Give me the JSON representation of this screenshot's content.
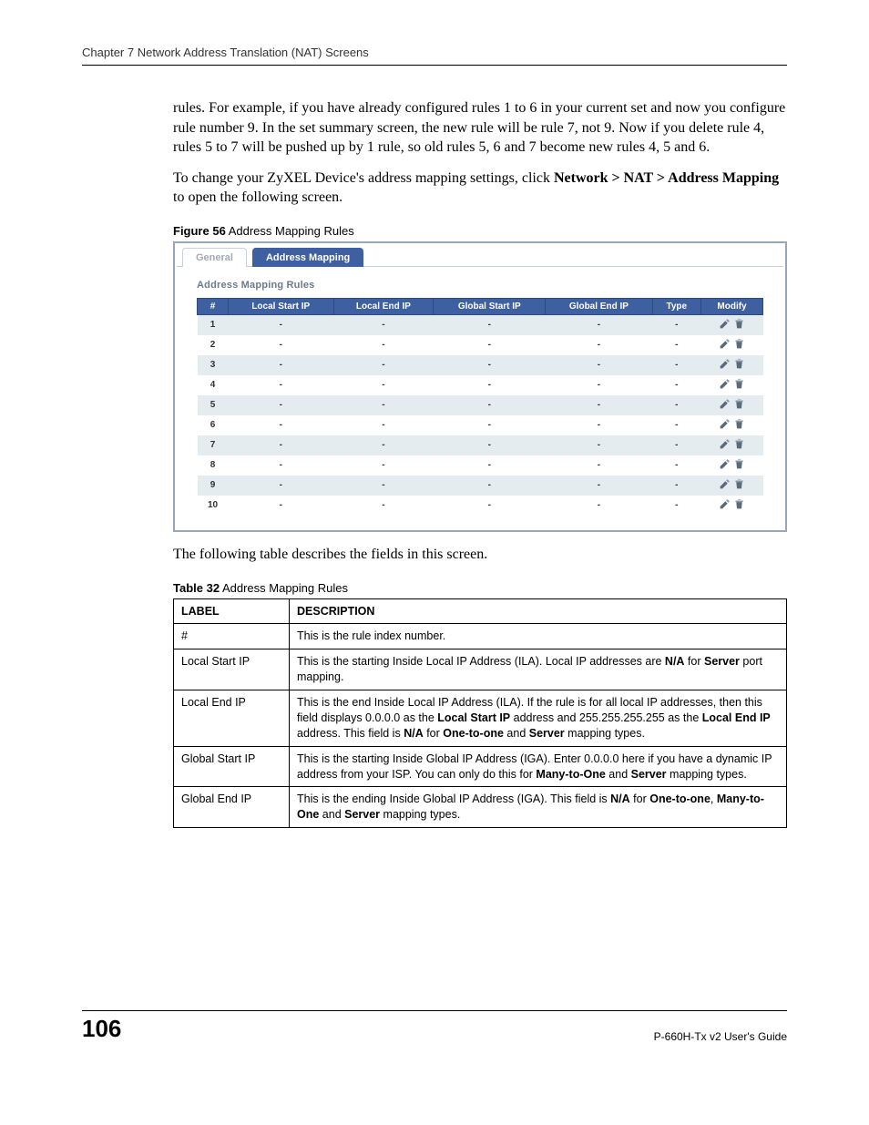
{
  "header": "Chapter 7 Network Address Translation (NAT) Screens",
  "para1_a": "rules. For example, if you have already configured rules 1 to 6 in your current set and now you configure rule number 9. In the set summary screen, the new rule will be rule 7, not 9. Now if you delete rule 4, rules 5 to 7 will be pushed up by 1 rule, so old rules 5, 6 and 7 become new rules 4, 5 and 6.",
  "para2_a": "To change your ZyXEL Device's address mapping settings, click ",
  "para2_b": "Network > NAT > Address Mapping",
  "para2_c": " to open the following screen.",
  "figure_caption_bold": "Figure 56",
  "figure_caption_rest": "   Address Mapping Rules",
  "tabs": {
    "general": "General",
    "mapping": "Address Mapping"
  },
  "panel_title": "Address Mapping Rules",
  "cols": {
    "idx": "#",
    "lstart": "Local Start IP",
    "lend": "Local End IP",
    "gstart": "Global Start IP",
    "gend": "Global End IP",
    "type": "Type",
    "modify": "Modify"
  },
  "rows": [
    {
      "n": "1",
      "a": "-",
      "b": "-",
      "c": "-",
      "d": "-",
      "e": "-"
    },
    {
      "n": "2",
      "a": "-",
      "b": "-",
      "c": "-",
      "d": "-",
      "e": "-"
    },
    {
      "n": "3",
      "a": "-",
      "b": "-",
      "c": "-",
      "d": "-",
      "e": "-"
    },
    {
      "n": "4",
      "a": "-",
      "b": "-",
      "c": "-",
      "d": "-",
      "e": "-"
    },
    {
      "n": "5",
      "a": "-",
      "b": "-",
      "c": "-",
      "d": "-",
      "e": "-"
    },
    {
      "n": "6",
      "a": "-",
      "b": "-",
      "c": "-",
      "d": "-",
      "e": "-"
    },
    {
      "n": "7",
      "a": "-",
      "b": "-",
      "c": "-",
      "d": "-",
      "e": "-"
    },
    {
      "n": "8",
      "a": "-",
      "b": "-",
      "c": "-",
      "d": "-",
      "e": "-"
    },
    {
      "n": "9",
      "a": "-",
      "b": "-",
      "c": "-",
      "d": "-",
      "e": "-"
    },
    {
      "n": "10",
      "a": "-",
      "b": "-",
      "c": "-",
      "d": "-",
      "e": "-"
    }
  ],
  "intro_after_fig": "The following table describes the fields in this screen.",
  "table_caption_bold": "Table 32",
  "table_caption_rest": "   Address Mapping Rules",
  "desc_headers": {
    "label": "LABEL",
    "desc": "DESCRIPTION"
  },
  "desc_rows": {
    "r1": {
      "label": "#",
      "text": "This is the rule index number."
    },
    "r2": {
      "label": "Local Start IP",
      "t1": "This is the starting Inside Local IP Address (ILA). Local IP addresses are ",
      "b1": "N/A",
      "t2": " for ",
      "b2": "Server",
      "t3": " port mapping."
    },
    "r3": {
      "label": "Local End IP",
      "t1": "This is the end Inside Local IP Address (ILA). If the rule is for all local IP addresses, then this field displays 0.0.0.0 as the ",
      "b1": "Local Start IP",
      "t2": " address and 255.255.255.255 as the ",
      "b2": "Local End IP",
      "t3": " address. This field is ",
      "b3": "N/A",
      "t4": " for ",
      "b4": "One-to-one",
      "t5": " and ",
      "b5": "Server",
      "t6": " mapping types."
    },
    "r4": {
      "label": "Global Start IP",
      "t1": "This is the starting Inside Global IP Address (IGA). Enter 0.0.0.0 here if you have a dynamic IP address from your ISP. You can only do this for ",
      "b1": "Many-to-One",
      "t2": " and ",
      "b2": "Server",
      "t3": " mapping types."
    },
    "r5": {
      "label": "Global End IP",
      "t1": "This is the ending Inside Global IP Address (IGA). This field is ",
      "b1": "N/A",
      "t2": " for ",
      "b2": "One-to-one",
      "t3": ", ",
      "b3": "Many-to-One",
      "t4": " and ",
      "b4": "Server",
      "t5": " mapping types."
    }
  },
  "footer": {
    "page": "106",
    "guide": "P-660H-Tx v2 User's Guide"
  }
}
